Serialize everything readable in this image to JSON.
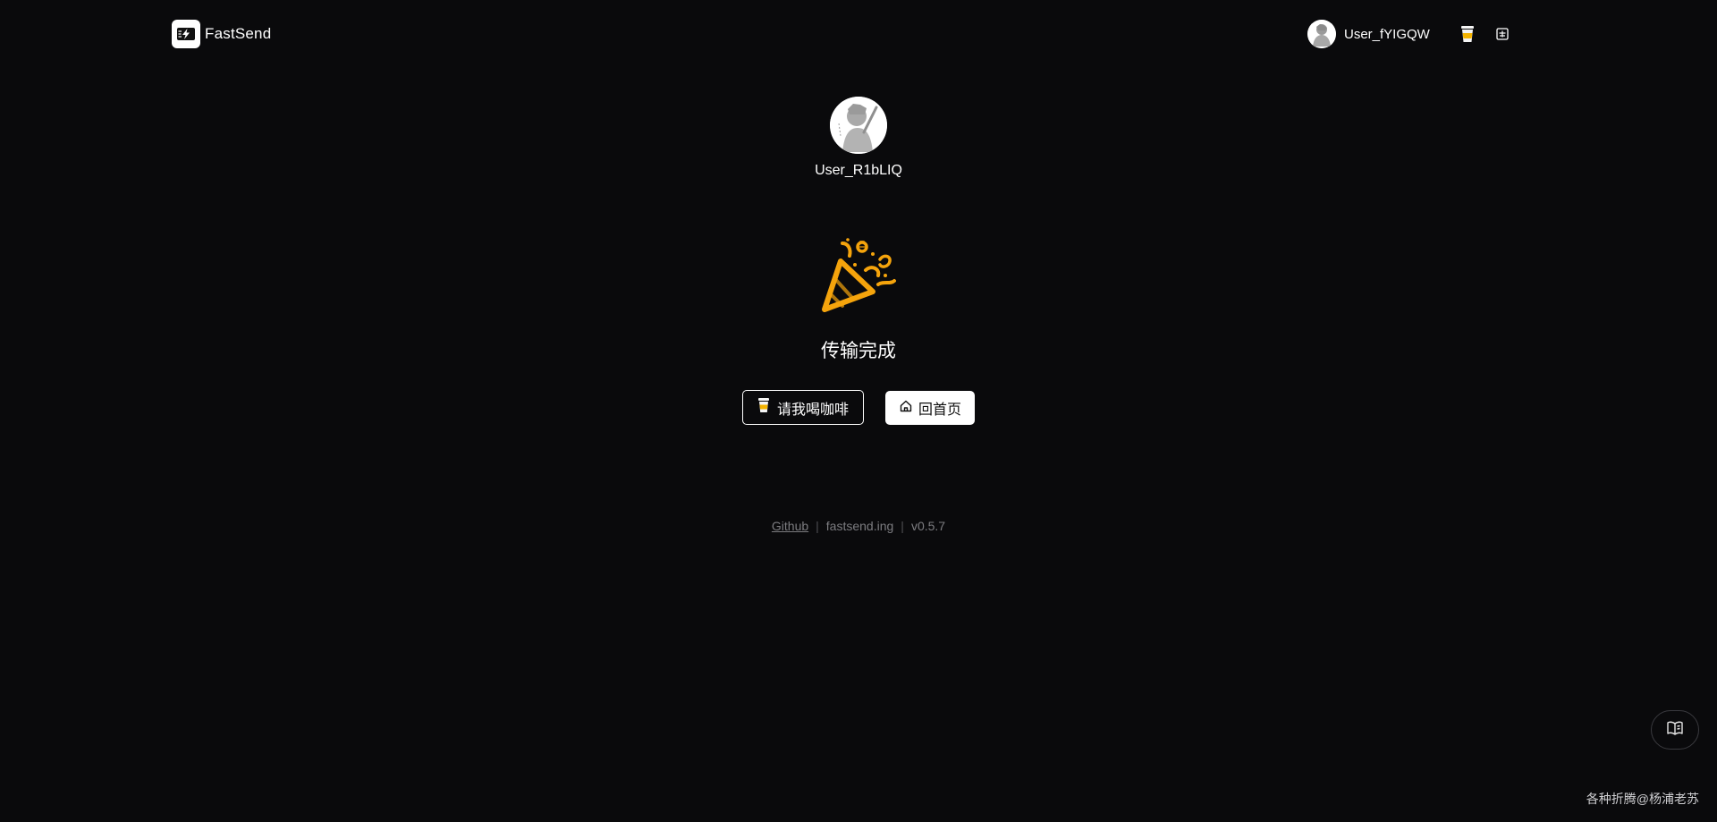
{
  "header": {
    "app_name": "FastSend",
    "username": "User_fYIGQW",
    "icons": {
      "logo": "lightning-bolt-icon",
      "coffee": "coffee-cup-icon",
      "language": "translate-icon"
    }
  },
  "main": {
    "peer_name": "User_R1bLIQ",
    "status_text": "传输完成",
    "status_icon": "party-popper-icon",
    "coffee_button_label": "请我喝咖啡",
    "home_button_label": "回首页"
  },
  "footer": {
    "github_label": "Github",
    "domain": "fastsend.ing",
    "version": "v0.5.7"
  },
  "floating": {
    "icon": "book-icon"
  },
  "watermark": "各种折腾@杨浦老苏",
  "colors": {
    "background": "#0a0a0c",
    "accent": "#f5a40c",
    "text": "#ffffff",
    "muted": "#7c7c80"
  }
}
